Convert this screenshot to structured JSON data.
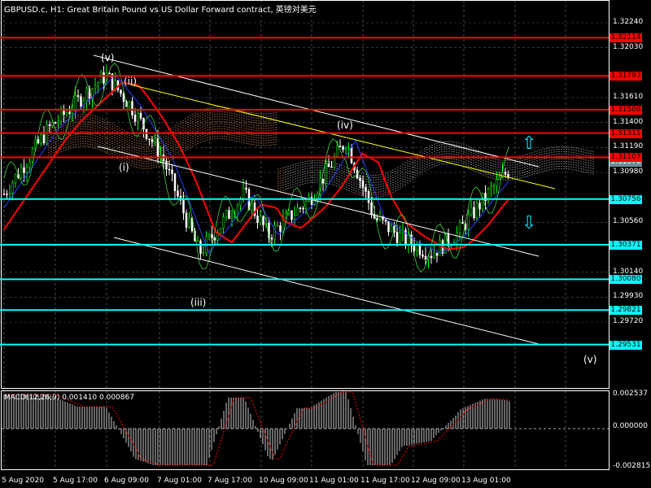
{
  "title": "GBPUSD.c, H1:  Great Britain Pound vs US Dollar Forward contract, 英镑对美元",
  "price_axis": [
    "1.32240",
    "1.32030",
    "1.31610",
    "1.31400",
    "1.31190",
    "1.30980",
    "1.30560",
    "1.30140",
    "1.29930",
    "1.29720"
  ],
  "price_axis_values": [
    1.3224,
    1.3203,
    1.3161,
    1.314,
    1.3119,
    1.3098,
    1.3056,
    1.3014,
    1.2993,
    1.2972
  ],
  "current_price": "1.31070",
  "current_price_value": 1.3107,
  "resistance_levels": [
    {
      "label": "1.32114",
      "value": 1.32114
    },
    {
      "label": "1.31793",
      "value": 1.31793
    },
    {
      "label": "1.31508",
      "value": 1.31508
    },
    {
      "label": "1.31311",
      "value": 1.31311
    },
    {
      "label": "1.31107",
      "value": 1.31107
    }
  ],
  "support_levels": [
    {
      "label": "1.30756",
      "value": 1.30756
    },
    {
      "label": "1.30371",
      "value": 1.30371
    },
    {
      "label": "1.30080",
      "value": 1.3008
    },
    {
      "label": "1.29821",
      "value": 1.29821
    },
    {
      "label": "1.29531",
      "value": 1.29531
    }
  ],
  "wave_labels": [
    "(v)",
    "(ii)",
    "(i)",
    "(iii)",
    "(iv)",
    "(v)"
  ],
  "macd": {
    "label": "MACD(12,26,9) 0.001410 0.000867",
    "axis": [
      "0.002537",
      "0.000000",
      "-0.002815"
    ]
  },
  "time_axis": [
    "5 Aug 2020",
    "5 Aug 17:00",
    "6 Aug 09:00",
    "7 Aug 01:00",
    "7 Aug 17:00",
    "10 Aug 09:00",
    "11 Aug 01:00",
    "11 Aug 17:00",
    "12 Aug 09:00",
    "13 Aug 01:00"
  ],
  "colors": {
    "resistance": "#ff0000",
    "support": "#00ffff",
    "bull": "#00ff00",
    "bear": "#ffffff"
  }
}
